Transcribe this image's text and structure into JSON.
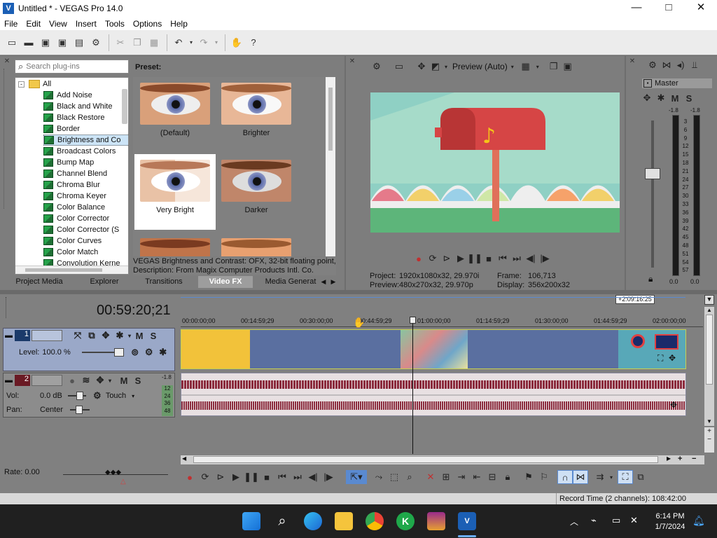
{
  "window": {
    "title": "Untitled * - VEGAS Pro 14.0",
    "minimize": "—",
    "maximize": "□",
    "close": "✕"
  },
  "menu": [
    "File",
    "Edit",
    "View",
    "Insert",
    "Tools",
    "Options",
    "Help"
  ],
  "plugins": {
    "search_placeholder": "Search plug-ins",
    "root": "All",
    "items": [
      "Add Noise",
      "Black and White",
      "Black Restore",
      "Border",
      "Brightness and Co",
      "Broadcast Colors",
      "Bump Map",
      "Channel Blend",
      "Chroma Blur",
      "Chroma Keyer",
      "Color Balance",
      "Color Corrector",
      "Color Corrector (S",
      "Color Curves",
      "Color Match",
      "Convolution Kerne"
    ],
    "selected_index": 4
  },
  "presets": {
    "heading": "Preset:",
    "items": [
      "(Default)",
      "Brighter",
      "Very Bright",
      "Darker"
    ],
    "selected_index": 2,
    "info_line1": "VEGAS Brightness and Contrast: OFX, 32-bit floating point, (",
    "info_line2": "Description: From Magix Computer Products Intl. Co."
  },
  "tabs": [
    "Project Media",
    "Explorer",
    "Transitions",
    "Video FX",
    "Media Generat"
  ],
  "active_tab": "Video FX",
  "preview": {
    "mode": "Preview (Auto)",
    "project_label": "Project:",
    "project_value": "1920x1080x32, 29.970i",
    "preview_label": "Preview:",
    "preview_value": "480x270x32, 29.970p",
    "frame_label": "Frame:",
    "frame_value": "106,713",
    "display_label": "Display:",
    "display_value": "356x200x32"
  },
  "master": {
    "title": "Master",
    "m": "M",
    "s": "S",
    "peak_left": "-1.8",
    "peak_right": "-1.8",
    "scale": [
      "3",
      "6",
      "9",
      "12",
      "15",
      "18",
      "21",
      "24",
      "27",
      "30",
      "33",
      "36",
      "39",
      "42",
      "45",
      "48",
      "51",
      "54",
      "57"
    ],
    "level_left": "0.0",
    "level_right": "0.0"
  },
  "timeline": {
    "timecode": "00:59:20;21",
    "end_marker": "+2:09:16:25",
    "ruler": [
      "00:00:00;00",
      "00:14:59;29",
      "00:30:00;00",
      "00:44:59;29",
      "01:00:00;00",
      "01:14:59;29",
      "01:30:00;00",
      "01:44:59;29",
      "02:00:00;00"
    ],
    "video_track": {
      "number": "1",
      "level_label": "Level:",
      "level_value": "100.0 %",
      "m": "M",
      "s": "S"
    },
    "audio_track": {
      "number": "2",
      "vol_label": "Vol:",
      "vol_value": "0.0 dB",
      "pan_label": "Pan:",
      "pan_value": "Center",
      "touch": "Touch",
      "m": "M",
      "s": "S",
      "peak": "-1.8",
      "meter": [
        "12",
        "24",
        "36",
        "48"
      ]
    },
    "rate": "Rate: 0.00"
  },
  "status": {
    "record_time": "Record Time (2 channels): 108:42:00"
  },
  "taskbar": {
    "time": "6:14 PM",
    "date": "1/7/2024"
  },
  "colors": {
    "video_clip": "#5a6fa0",
    "audio_wave": "#8b2a3c",
    "yellow_clip": "#f2c23a",
    "accent": "#1b5fb5"
  }
}
